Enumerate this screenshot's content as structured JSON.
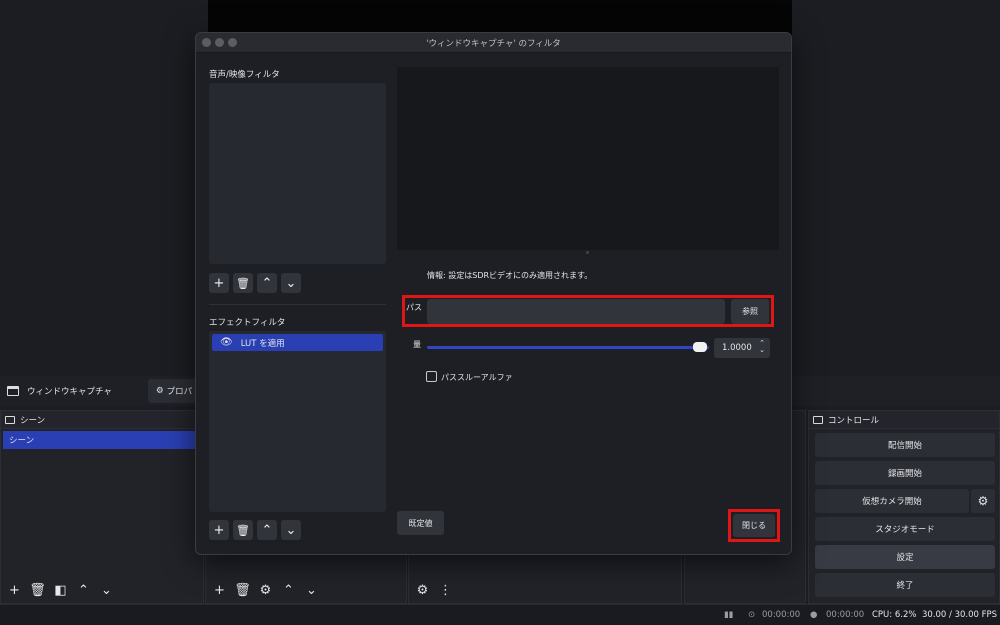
{
  "main": {
    "source_name": "ウィンドウキャプチャ",
    "properties_label": "プロパ",
    "scenes_title": "シーン",
    "scene_item": "シーン",
    "controls_title": "コントロール",
    "controls": [
      "配信開始",
      "録画開始",
      "仮想カメラ開始",
      "スタジオモード",
      "設定",
      "終了"
    ]
  },
  "status": {
    "time1": "00:00:00",
    "time2": "00:00:00",
    "cpu": "CPU: 6.2%",
    "fps": "30.00 / 30.00 FPS"
  },
  "dialog": {
    "title": "'ウィンドウキャプチャ' のフィルタ",
    "av_filters_label": "音声/映像フィルタ",
    "effect_filters_label": "エフェクトフィルタ",
    "selected_filter": "LUT を適用",
    "info_text": "情報: 設定はSDRビデオにのみ適用されます。",
    "path_label": "パス",
    "path_value": "",
    "browse_label": "参照",
    "amount_label": "量",
    "amount_value": "1.0000",
    "amount_fraction": 1.0,
    "passthrough_alpha_label": "パススルーアルファ",
    "passthrough_alpha_checked": false,
    "defaults_label": "既定値",
    "close_label": "閉じる"
  },
  "colors": {
    "selection": "#2a3fb3",
    "highlight": "#e01616"
  }
}
